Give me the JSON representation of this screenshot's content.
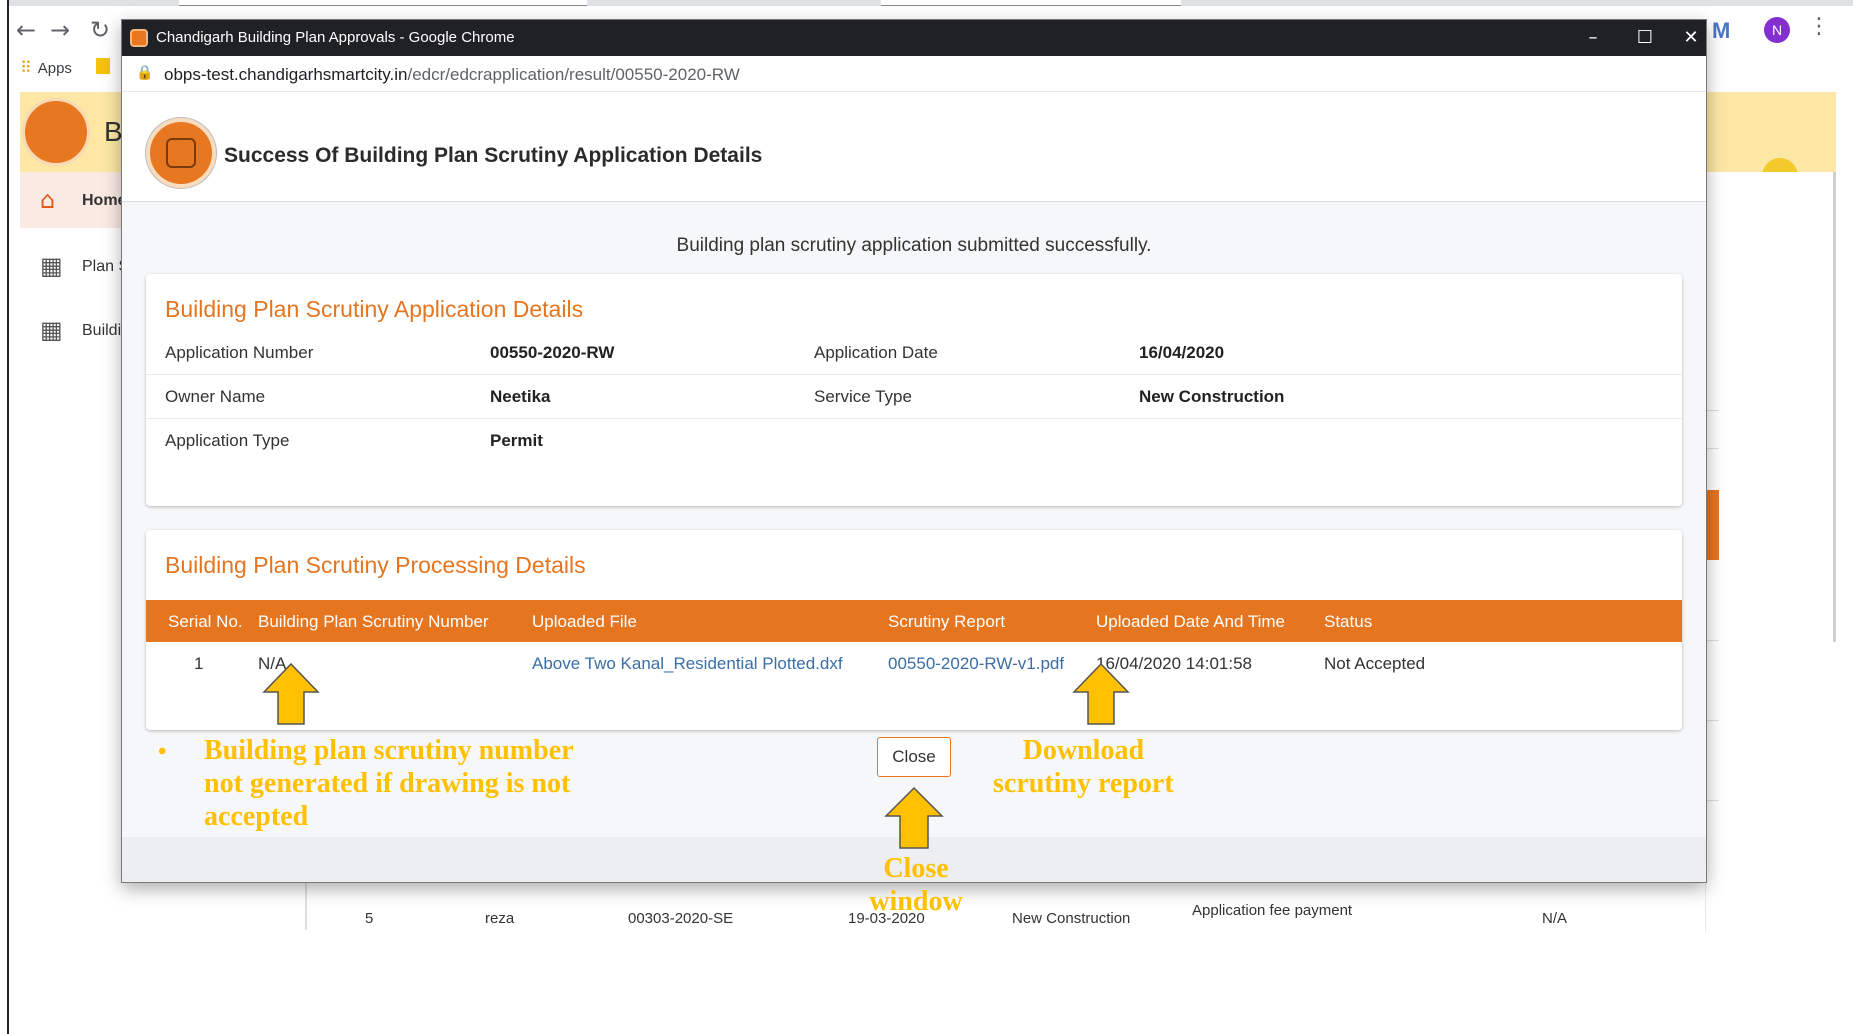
{
  "background": {
    "bookmarks": {
      "apps_label": "Apps"
    },
    "profile_initial": "N",
    "header_title_partial": "B",
    "sidebar": [
      {
        "label": "Home",
        "icon": "home-icon",
        "active": true
      },
      {
        "label": "Plan S",
        "icon": "building-icon",
        "active": false
      },
      {
        "label": "Buildi",
        "icon": "building-icon",
        "active": false
      }
    ],
    "table_row": {
      "serial": "5",
      "name": "reza",
      "app_no": "00303-2020-SE",
      "date": "19-03-2020",
      "service": "New Construction",
      "status_line": "Application fee payment",
      "status_sub": "..",
      "col_last": "N/A"
    }
  },
  "popup": {
    "window_title": "Chandigarh Building Plan Approvals - Google Chrome",
    "url_host": "obps-test.chandigarhsmartcity.in",
    "url_path": "/edcr/edcrapplication/result/00550-2020-RW",
    "page_title": "Success Of Building Plan Scrutiny Application Details",
    "success_message": "Building plan scrutiny application submitted successfully.",
    "application_card": {
      "title": "Building Plan Scrutiny Application Details",
      "fields": {
        "application_number_label": "Application Number",
        "application_number": "00550-2020-RW",
        "application_date_label": "Application Date",
        "application_date": "16/04/2020",
        "owner_name_label": "Owner Name",
        "owner_name": "Neetika",
        "service_type_label": "Service Type",
        "service_type": "New Construction",
        "application_type_label": "Application Type",
        "application_type": "Permit"
      }
    },
    "processing_card": {
      "title": "Building Plan Scrutiny Processing Details",
      "columns": [
        "Serial No.",
        "Building Plan Scrutiny Number",
        "Uploaded File",
        "Scrutiny Report",
        "Uploaded Date And Time",
        "Status"
      ],
      "rows": [
        {
          "serial": "1",
          "scrutiny_number": "N/A",
          "uploaded_file": "Above Two Kanal_Residential Plotted.dxf",
          "scrutiny_report": "00550-2020-RW-v1.pdf",
          "uploaded_at": "16/04/2020 14:01:58",
          "status": "Not Accepted"
        }
      ]
    },
    "close_label": "Close"
  },
  "annotations": {
    "note_left": [
      "Building plan scrutiny number",
      "not generated if drawing is not",
      "accepted"
    ],
    "note_download": [
      "Download",
      "scrutiny report"
    ],
    "note_close": [
      "Close",
      "window"
    ],
    "color": "#ffc000"
  },
  "colors": {
    "accent": "#e5751f",
    "link": "#3a6ea5",
    "titlebar": "#202124",
    "header_bg": "#fce7a4"
  }
}
